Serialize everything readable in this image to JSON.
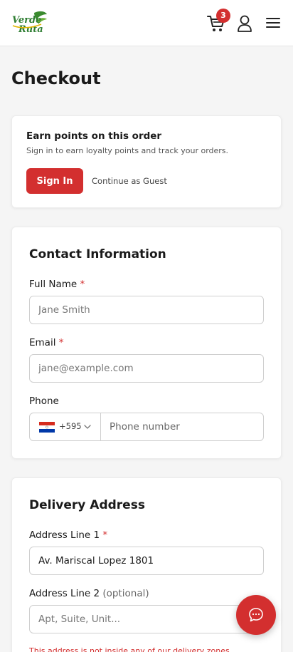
{
  "header": {
    "logo_alt": "Verde Ruta",
    "cart_count": "3"
  },
  "page": {
    "title": "Checkout"
  },
  "signin": {
    "title": "Earn points on this order",
    "subtitle": "Sign in to earn loyalty points and track your orders.",
    "signin_label": "Sign In",
    "guest_label": "Continue as Guest"
  },
  "contact": {
    "title": "Contact Information",
    "full_name_label": "Full Name",
    "full_name_placeholder": "Jane Smith",
    "email_label": "Email",
    "email_placeholder": "jane@example.com",
    "phone_label": "Phone",
    "country_code": "+595",
    "phone_placeholder": "Phone number",
    "required_mark": "*"
  },
  "address": {
    "title": "Delivery Address",
    "line1_label": "Address Line 1",
    "line1_value": "Av. Mariscal Lopez 1801",
    "line2_label": "Address Line 2",
    "line2_optional": "(optional)",
    "line2_placeholder": "Apt, Suite, Unit...",
    "error": "This address is not inside any of our delivery zones."
  },
  "colors": {
    "accent": "#d32f2f",
    "background": "#f5f5f5",
    "card": "#ffffff"
  }
}
